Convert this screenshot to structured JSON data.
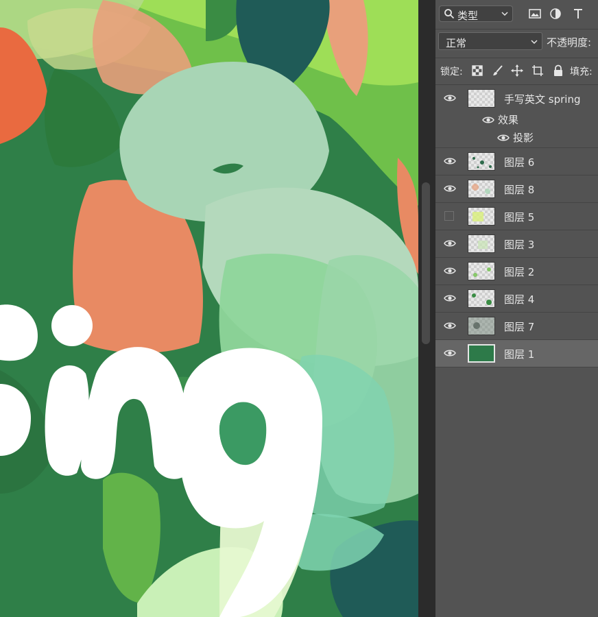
{
  "canvas": {
    "artwork": "spring lettering illustration",
    "colors": {
      "background": "#2f7f48",
      "mint": "#a8d5b5",
      "salmon": "#e88a63",
      "lime": "#8fd64a",
      "teal": "#1f5b57",
      "white": "#ffffff"
    }
  },
  "layers_panel": {
    "filter": {
      "icon": "search-icon",
      "label": "类型"
    },
    "filter_icons": [
      "image-filter-icon",
      "adjustment-filter-icon",
      "text-filter-icon"
    ],
    "blend_mode": "正常",
    "opacity_label": "不透明度:",
    "lock_label": "锁定:",
    "lock_icons": [
      "lock-transparent-icon",
      "lock-paint-icon",
      "lock-position-icon",
      "lock-artboard-icon",
      "lock-all-icon"
    ],
    "fill_label": "填充:",
    "layers": [
      {
        "name": "手写英文 spring",
        "visible": true
      },
      {
        "name": "图层 6",
        "visible": true
      },
      {
        "name": "图层 8",
        "visible": true
      },
      {
        "name": "图层 5",
        "visible": false
      },
      {
        "name": "图层 3",
        "visible": true
      },
      {
        "name": "图层 2",
        "visible": true
      },
      {
        "name": "图层 4",
        "visible": true
      },
      {
        "name": "图层 7",
        "visible": true
      },
      {
        "name": "图层 1",
        "visible": true,
        "selected": true
      }
    ],
    "effects": {
      "label": "效果",
      "items": [
        "投影"
      ]
    }
  }
}
